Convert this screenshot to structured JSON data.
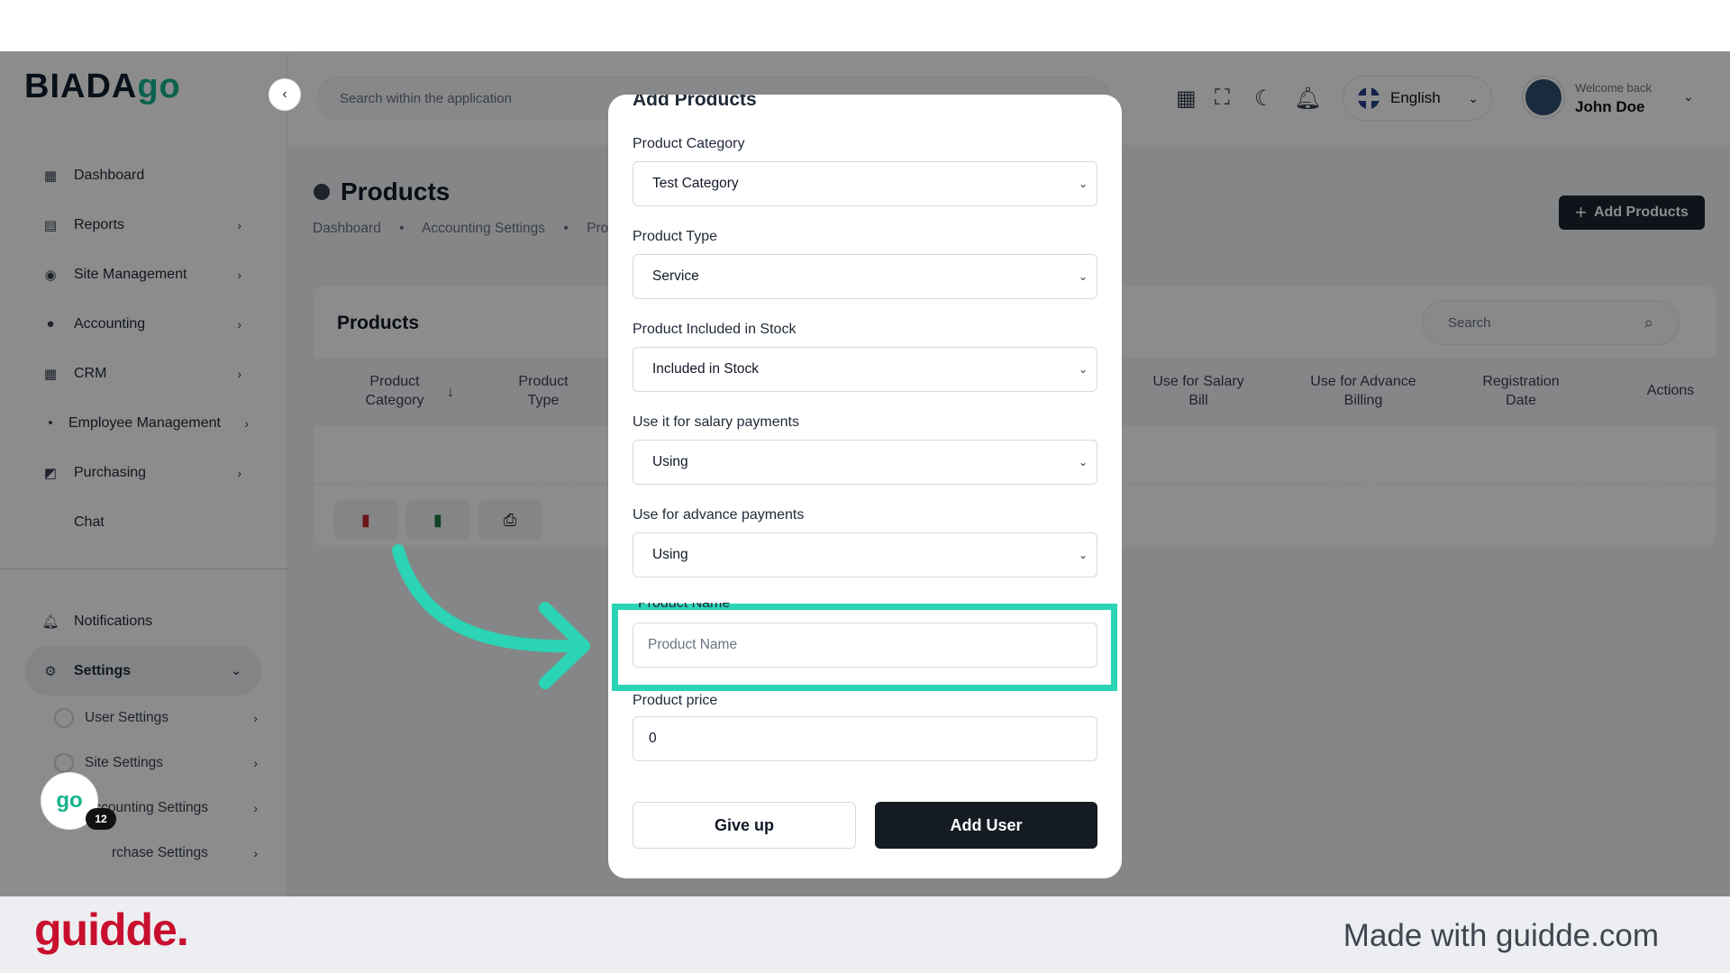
{
  "app": {
    "logo_text": "BIADA",
    "logo_go": "go"
  },
  "sidebar": {
    "items": [
      {
        "label": "Dashboard",
        "icon": "dashboard-icon",
        "chevron": false
      },
      {
        "label": "Reports",
        "icon": "reports-icon",
        "chevron": true
      },
      {
        "label": "Site Management",
        "icon": "site-icon",
        "chevron": true
      },
      {
        "label": "Accounting",
        "icon": "accounting-icon",
        "chevron": true
      },
      {
        "label": "CRM",
        "icon": "crm-icon",
        "chevron": true
      },
      {
        "label": "Employee Management",
        "icon": "employee-icon",
        "chevron": true
      },
      {
        "label": "Purchasing",
        "icon": "purchasing-icon",
        "chevron": true
      },
      {
        "label": "Chat",
        "icon": "",
        "chevron": false
      }
    ],
    "notifications": "Notifications",
    "settings": "Settings",
    "sub_items": [
      {
        "label": "User Settings"
      },
      {
        "label": "Site Settings"
      },
      {
        "label": "Accounting Settings"
      },
      {
        "label": "rchase Settings"
      }
    ],
    "badge_text": "go",
    "badge_count": "12"
  },
  "topbar": {
    "search_placeholder": "Search within the application",
    "language": "English",
    "welcome": "Welcome back",
    "user_name": "John Doe"
  },
  "page": {
    "title": "Products",
    "breadcrumb": [
      "Dashboard",
      "•",
      "Accounting Settings",
      "•",
      "Pro"
    ],
    "add_button": "Add Products",
    "card_title": "Products",
    "search_placeholder": "Search",
    "columns": [
      {
        "label": "Product\nCategory"
      },
      {
        "label": "Product\nType"
      },
      {
        "label": "Use for Salary\nBill"
      },
      {
        "label": "Use for Advance\nBilling"
      },
      {
        "label": "Registration\nDate"
      },
      {
        "label": "Actions"
      }
    ]
  },
  "modal": {
    "title": "Add Products",
    "fields": {
      "category": {
        "label": "Product Category",
        "value": "Test Category"
      },
      "type": {
        "label": "Product Type",
        "value": "Service"
      },
      "stock": {
        "label": "Product Included in Stock",
        "value": "Included in Stock"
      },
      "salary": {
        "label": "Use it for salary payments",
        "value": "Using"
      },
      "advance": {
        "label": "Use for advance payments",
        "value": "Using"
      },
      "name": {
        "label": "Product Name",
        "placeholder": "Product Name"
      },
      "price": {
        "label": "Product price",
        "value": "0"
      }
    },
    "give_up": "Give up",
    "add_user": "Add User"
  },
  "footer": {
    "logo": "guidde.",
    "made_with": "Made with guidde.com"
  },
  "colors": {
    "accent": "#2ad4b5",
    "brand_red": "#c8102e",
    "dark_button": "#151b22"
  }
}
